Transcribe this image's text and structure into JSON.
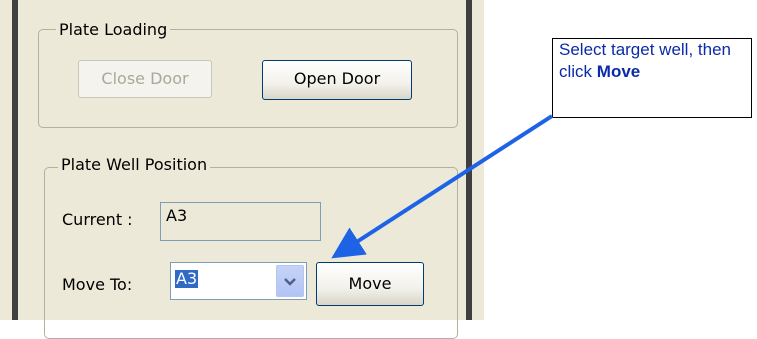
{
  "plate_loading": {
    "title": "Plate Loading",
    "close_door_label": "Close Door",
    "open_door_label": "Open Door"
  },
  "plate_well_position": {
    "title": "Plate Well Position",
    "current_label": "Current :",
    "current_value": "A3",
    "move_to_label": "Move To:",
    "move_to_value": "A3",
    "move_label": "Move"
  },
  "callout": {
    "text": "Select target well, then click",
    "bold_text": "Move"
  },
  "colors": {
    "callout_text": "#0b2ba8",
    "arrow": "#1e63e6",
    "selection": "#316ac5"
  },
  "icons": {
    "dropdown": "chevron-down-icon",
    "annotation": "arrow-icon"
  }
}
